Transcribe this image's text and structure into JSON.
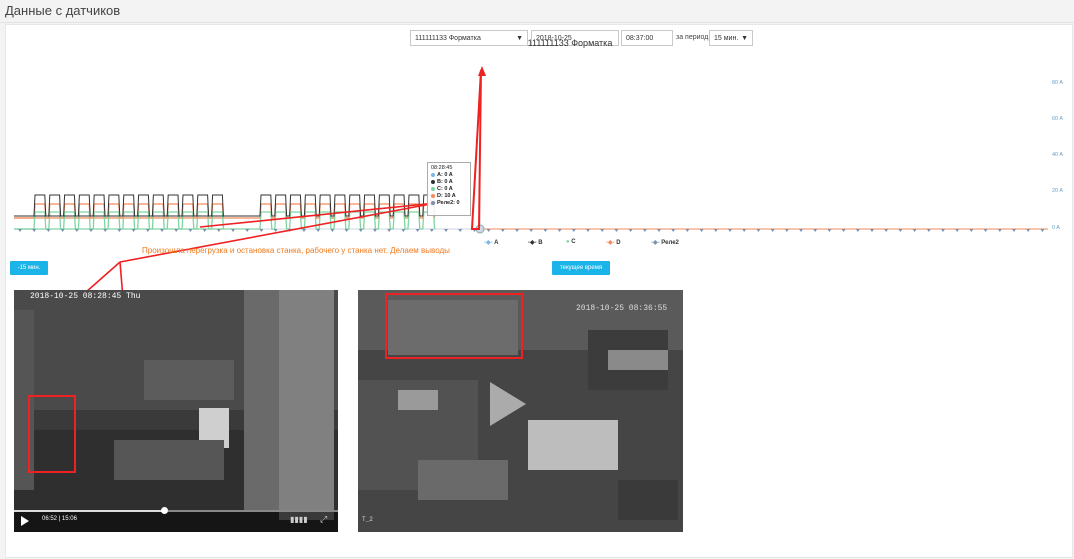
{
  "header": {
    "title": "Данные с датчиков"
  },
  "controls": {
    "sensor_select": "111111133 Форматка",
    "date": "2018-10-25",
    "time": "08:37:00",
    "period_label": "за период",
    "period_select": "15 мин."
  },
  "chart_data": {
    "type": "line",
    "title": "111111133 Форматка",
    "yticks": [
      "80 A",
      "60 A",
      "40 A",
      "20 A",
      "0 A"
    ],
    "ylim": [
      0,
      80
    ],
    "legend": [
      "A",
      "B",
      "C",
      "D",
      "Реле2"
    ],
    "legend_placement": "bottom",
    "colors": {
      "A": "#7ab6e8",
      "B": "#333333",
      "C": "#7fd4a0",
      "D": "#f28b5a",
      "Реле2": "#7a8fb0"
    }
  },
  "tooltip": {
    "time": "08:28:45",
    "rows": [
      {
        "label": "A: 0 A",
        "color": "#7ab6e8"
      },
      {
        "label": "B: 0 A",
        "color": "#333333"
      },
      {
        "label": "C: 0 A",
        "color": "#7fd4a0"
      },
      {
        "label": "D: 10 A",
        "color": "#f28b5a"
      },
      {
        "label": "Реле2: 0",
        "color": "#7a8fb0"
      }
    ]
  },
  "buttons": {
    "minus15": "-15 мин.",
    "current_time": "текущее время"
  },
  "annotation": "Произошла перегрузка и остановка станка, рабочего у станка нет. Делаем выводы",
  "video_left": {
    "timestamp": "2018-10-25 08:28:45 Thu",
    "time": "06:52 | 15:06"
  },
  "video_right": {
    "timestamp": "2018-10-25 08:36:55",
    "camera": "T_2"
  }
}
